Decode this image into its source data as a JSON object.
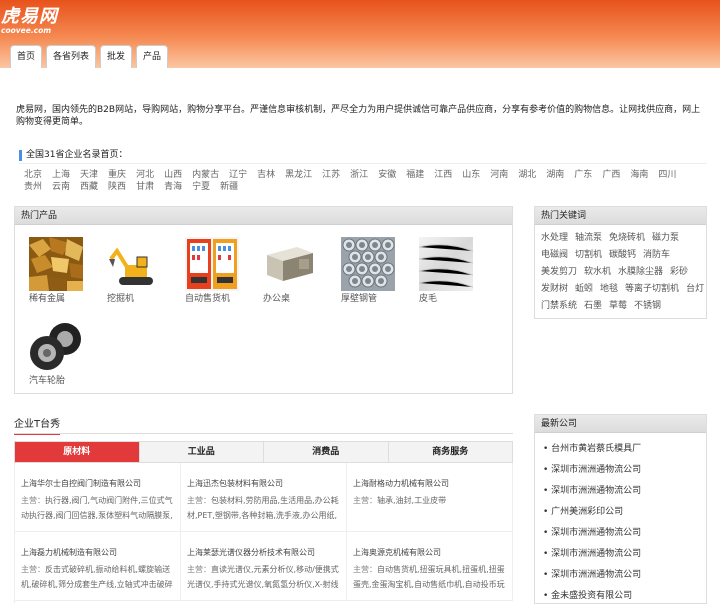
{
  "logo": {
    "cn": "虎易网",
    "en": "coovee.com"
  },
  "nav": {
    "items": [
      "首页",
      "各省列表",
      "批发",
      "产品"
    ]
  },
  "intro": "虎易网，国内领先的B2B网站，导购网站，购物分享平台。严谨信息审核机制，严尽全力为用户提供诚信可靠产品供应商，分享有参考价值的购物信息。让网找供应商，网上购物变得更简单。",
  "provinces": {
    "title": "全国31省企业名录首页：",
    "list": [
      "北京",
      "上海",
      "天津",
      "重庆",
      "河北",
      "山西",
      "内蒙古",
      "辽宁",
      "吉林",
      "黑龙江",
      "江苏",
      "浙江",
      "安徽",
      "福建",
      "江西",
      "山东",
      "河南",
      "湖北",
      "湖南",
      "广东",
      "广西",
      "海南",
      "四川",
      "贵州",
      "云南",
      "西藏",
      "陕西",
      "甘肃",
      "青海",
      "宁夏",
      "新疆"
    ]
  },
  "hot_products": {
    "title": "热门产品",
    "items": [
      {
        "label": "稀有金属",
        "icon": "scrap-metal-image"
      },
      {
        "label": "挖掘机",
        "icon": "excavator-image"
      },
      {
        "label": "自动售货机",
        "icon": "vending-machine-image"
      },
      {
        "label": "办公桌",
        "icon": "office-desk-image"
      },
      {
        "label": "厚壁钢管",
        "icon": "steel-pipes-image"
      },
      {
        "label": "皮毛",
        "icon": "fur-image"
      },
      {
        "label": "汽车轮胎",
        "icon": "car-tires-image"
      }
    ]
  },
  "hot_keywords": {
    "title": "热门关键词",
    "items": [
      "水处理",
      "轴流泵",
      "免烧砖机",
      "磁力泵",
      "电磁阀",
      "切割机",
      "碳酸钙",
      "消防车",
      "美发剪刀",
      "软水机",
      "水膜除尘器",
      "彩砂",
      "发财树",
      "蚯蚓",
      "地毯",
      "等离子切割机",
      "台灯",
      "门禁系统",
      "石墨",
      "草莓",
      "不锈钢"
    ]
  },
  "taiwan": {
    "title": "企业T台秀",
    "tabs": [
      "原材料",
      "工业品",
      "消费品",
      "商务服务"
    ],
    "active_tab": 0,
    "companies": [
      {
        "name": "上海华尔士自控阀门制造有限公司",
        "main_label": "主营：",
        "main": "执行器,阀门,气动阀门附件,三位式气动执行器,阀门回信器,泵体塑料气动隔膜泵,"
      },
      {
        "name": "上海迅杰包装材料有限公司",
        "main_label": "主营：",
        "main": "包装材料,劳防用品,生活用品,办公耗材,PET,塑钢带,各种封箱,洗手液,办公用纸,各"
      },
      {
        "name": "上海耐格动力机械有限公司",
        "main_label": "主营：",
        "main": "轴承,油封,工业皮带"
      },
      {
        "name": "上海磊力机械制造有限公司",
        "main_label": "主营：",
        "main": "反击式破碎机,振动给料机,螺旋输送机,破碎机,筛分成套生产线,立轴式冲击破碎机,"
      },
      {
        "name": "上海莱瑟光谱仪器分析技术有限公司",
        "main_label": "主营：",
        "main": "直读光谱仪,元素分析仪,移动/便携式光谱仪,手持式光谱仪,氧氮氢分析仪,X-射线"
      },
      {
        "name": "上海奥源克机械有限公司",
        "main_label": "主营：",
        "main": "自动售货机,扭蛋玩具机,扭蛋机,扭蛋蛋壳,金蛋淘宝机,自动售纸巾机,自动投币玩"
      }
    ]
  },
  "new_companies": {
    "title": "最新公司",
    "items": [
      "台州市黄岩蔡氏模具厂",
      "深圳市洲洲通物流公司",
      "深圳市洲洲通物流公司",
      "广州美洲彩印公司",
      "深圳市洲洲通物流公司",
      "深圳市洲洲通物流公司",
      "深圳市洲洲通物流公司",
      "金未盛投资有限公司"
    ]
  },
  "colors": {
    "brand": "#f26522",
    "accent_red": "#e23a3a",
    "accent_blue": "#4a90e2"
  }
}
